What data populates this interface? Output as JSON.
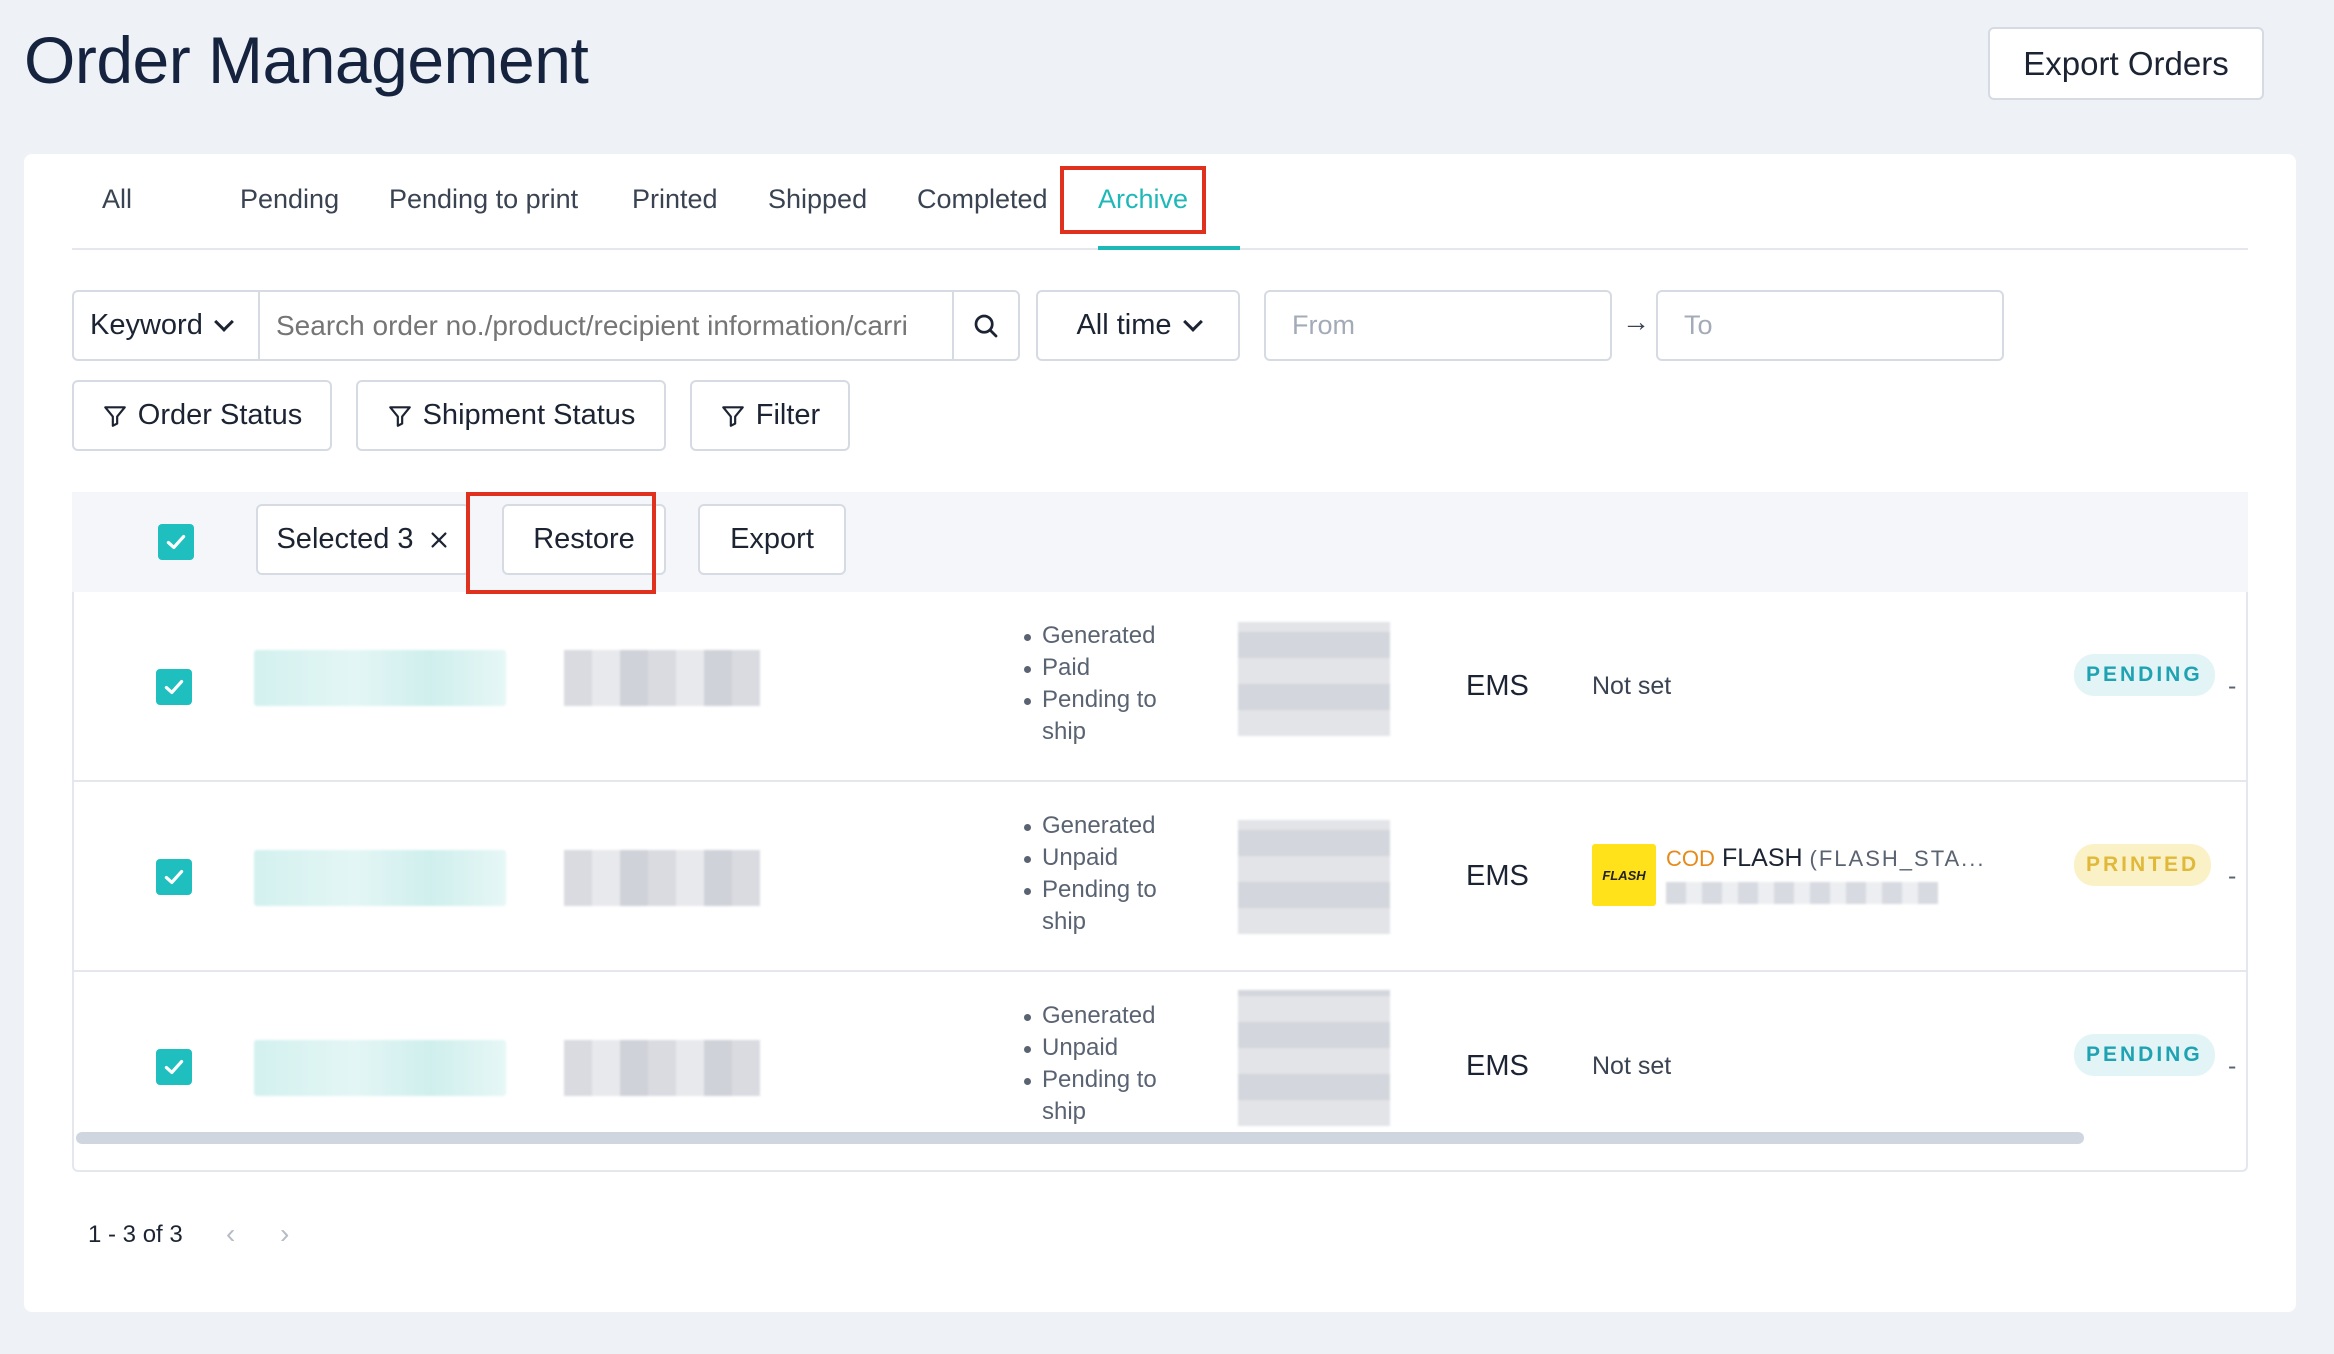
{
  "page": {
    "title": "Order Management",
    "export_orders_label": "Export Orders"
  },
  "tabs": [
    {
      "label": "All"
    },
    {
      "label": "Pending"
    },
    {
      "label": "Pending to print"
    },
    {
      "label": "Printed"
    },
    {
      "label": "Shipped"
    },
    {
      "label": "Completed"
    },
    {
      "label": "Archive",
      "active": true
    }
  ],
  "search": {
    "keyword_label": "Keyword",
    "placeholder": "Search order no./product/recipient information/carri",
    "time_label": "All time",
    "from_placeholder": "From",
    "to_placeholder": "To",
    "arrow": "→"
  },
  "filters": {
    "order_status": "Order Status",
    "shipment_status": "Shipment Status",
    "filter": "Filter"
  },
  "selection": {
    "selected_label": "Selected 3",
    "restore_label": "Restore",
    "export_label": "Export"
  },
  "rows": [
    {
      "statuses": [
        "Generated",
        "Paid",
        "Pending to ship"
      ],
      "carrier": "EMS",
      "logistics": "Not set",
      "badge": "PENDING",
      "dash": "-"
    },
    {
      "statuses": [
        "Generated",
        "Unpaid",
        "Pending to ship"
      ],
      "carrier": "EMS",
      "logistics": {
        "logo": "FLASH",
        "cod": "COD",
        "name": "FLASH",
        "code": "(FLASH_STA..."
      },
      "badge": "PRINTED",
      "dash": "-"
    },
    {
      "statuses": [
        "Generated",
        "Unpaid",
        "Pending to ship"
      ],
      "carrier": "EMS",
      "logistics": "Not set",
      "badge": "PENDING",
      "dash": "-"
    }
  ],
  "pagination": {
    "range": "1 - 3 of 3",
    "prev": "‹",
    "next": "›"
  },
  "colors": {
    "accent": "#1fbfbf",
    "annotation": "#e0301e",
    "pending": "#1fa3b3",
    "printed": "#e0b93a"
  },
  "icons": [
    "search-icon",
    "chevron-down-icon",
    "filter-icon",
    "close-icon",
    "check-icon",
    "arrow-right-icon"
  ]
}
